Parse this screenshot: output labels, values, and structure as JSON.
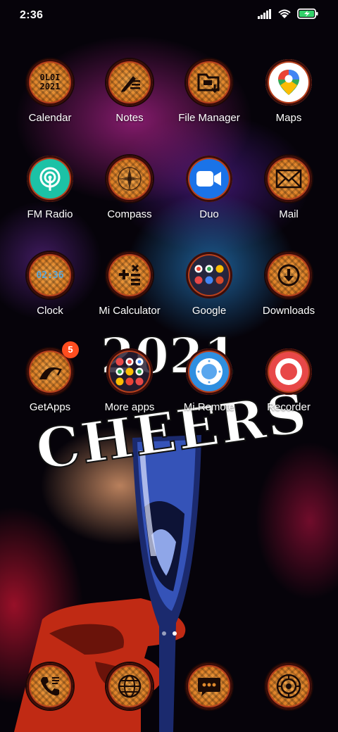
{
  "status_bar": {
    "time": "2:36"
  },
  "apps": [
    {
      "label": "Calendar",
      "icon": "calendar-icon",
      "icon_text": "0L0I\n2021"
    },
    {
      "label": "Notes",
      "icon": "notes-icon"
    },
    {
      "label": "File Manager",
      "icon": "file-manager-icon"
    },
    {
      "label": "Maps",
      "icon": "maps-icon"
    },
    {
      "label": "FM Radio",
      "icon": "fm-radio-icon"
    },
    {
      "label": "Compass",
      "icon": "compass-icon"
    },
    {
      "label": "Duo",
      "icon": "duo-icon"
    },
    {
      "label": "Mail",
      "icon": "mail-icon"
    },
    {
      "label": "Clock",
      "icon": "clock-icon",
      "icon_text": "02:36"
    },
    {
      "label": "Mi Calculator",
      "icon": "calculator-icon"
    },
    {
      "label": "Google",
      "icon": "google-folder-icon"
    },
    {
      "label": "Downloads",
      "icon": "downloads-icon"
    },
    {
      "label": "GetApps",
      "icon": "getapps-icon",
      "badge": "5"
    },
    {
      "label": "More apps",
      "icon": "more-apps-folder-icon"
    },
    {
      "label": "Mi Remote",
      "icon": "mi-remote-icon"
    },
    {
      "label": "Recorder",
      "icon": "recorder-icon"
    }
  ],
  "dock": [
    {
      "icon": "phone-icon"
    },
    {
      "icon": "browser-icon"
    },
    {
      "icon": "messaging-icon"
    },
    {
      "icon": "camera-icon"
    }
  ],
  "wallpaper": {
    "headline": "2021",
    "subline": "CHEERS"
  },
  "page_indicator": {
    "pages": 2,
    "current": 2
  },
  "colors": {
    "icon_orange": "#d9751c",
    "badge": "#ff4d1f",
    "duo_blue": "#1a73e8",
    "recorder_red": "#e84848"
  }
}
